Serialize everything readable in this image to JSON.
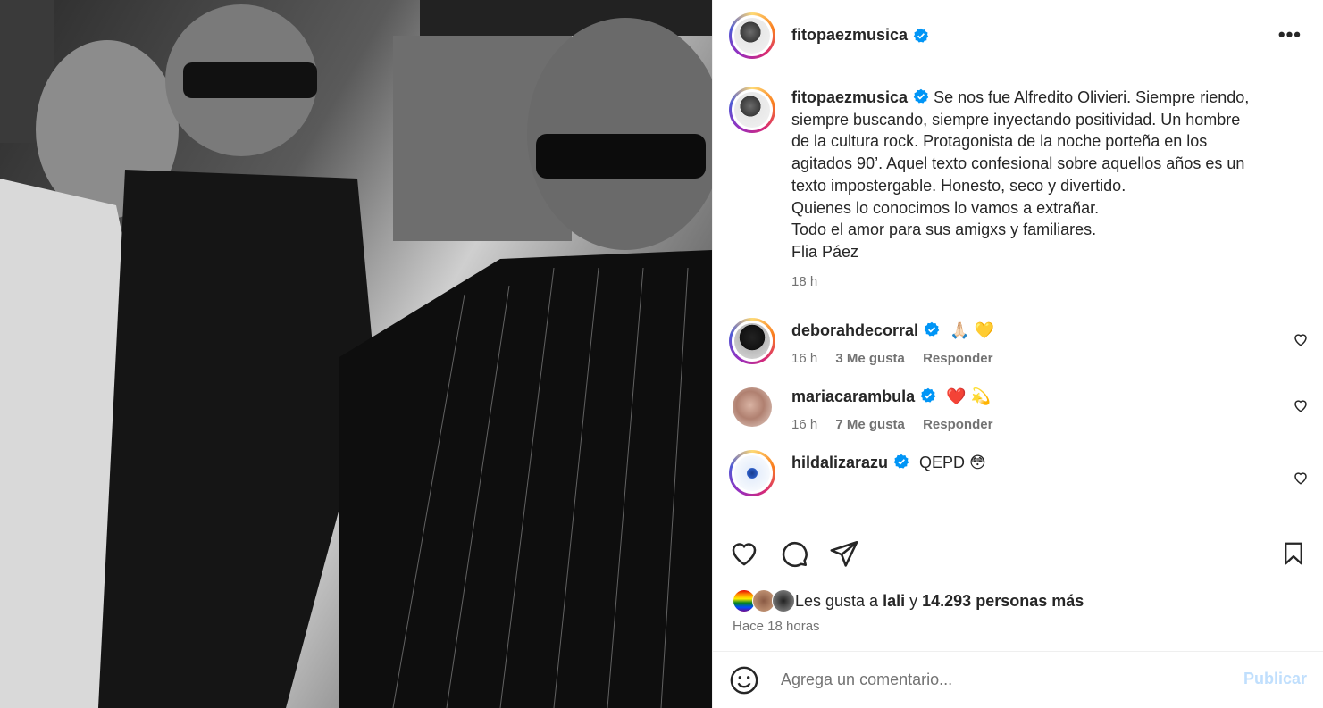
{
  "post": {
    "username": "fitopaezmusica",
    "more_label": "•••"
  },
  "caption": {
    "username": "fitopaezmusica",
    "lines": [
      "Se nos fue Alfredito Olivieri. Siempre riendo,",
      "siempre buscando, siempre inyectando positividad. Un hombre",
      "de la cultura rock. Protagonista de la noche porteña en los",
      "agitados 90’. Aquel texto confesional sobre aquellos años es un",
      "texto impostergable. Honesto, seco y divertido.",
      "Quienes lo conocimos lo vamos a extrañar.",
      "Todo el amor para sus amigxs y familiares.",
      "Flia Páez"
    ],
    "time": "18 h"
  },
  "comments": [
    {
      "username": "deborahdecorral",
      "text": "🙏🏻 💛",
      "time": "16 h",
      "likes": "3 Me gusta",
      "reply": "Responder"
    },
    {
      "username": "mariacarambula",
      "text": "❤️ 💫",
      "time": "16 h",
      "likes": "7 Me gusta",
      "reply": "Responder"
    },
    {
      "username": "hildalizarazu",
      "text": "QEPD 😳"
    }
  ],
  "likes": {
    "prefix": "Les gusta a",
    "user": "lali",
    "joiner": "y",
    "others": "14.293 personas más"
  },
  "timestamp": "Hace 18 horas",
  "composer": {
    "placeholder": "Agrega un comentario...",
    "publish": "Publicar"
  },
  "colors": {
    "verified": "#0095f6",
    "publish_disabled": "#c0dffd"
  }
}
